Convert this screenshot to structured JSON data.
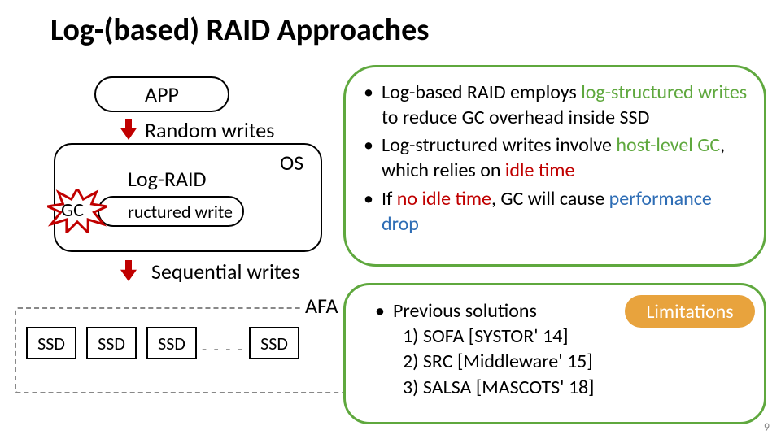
{
  "title": "Log-(based) RAID Approaches",
  "left": {
    "app": "APP",
    "random_writes": "Random writes",
    "os": "OS",
    "log_raid": "Log-RAID",
    "structured_write": "ructured write",
    "gc": "GC",
    "sequential_writes": "Sequential writes",
    "afa": "AFA",
    "ssd": "SSD",
    "dots": "- - - -"
  },
  "bubble1": {
    "b1_pre": "Log-based RAID employs ",
    "b1_hl": "log-structured writes",
    "b1_post": " to reduce GC overhead inside SSD",
    "b2_pre": "Log-structured writes involve ",
    "b2_hl": "host-level GC",
    "b2_mid": ", which relies on ",
    "b2_hl2": "idle time",
    "b3_pre": "If ",
    "b3_hl": "no idle time",
    "b3_mid": ", GC will cause ",
    "b3_hl2": "performance drop"
  },
  "lim": "Limitations",
  "bubble2": {
    "head": "Previous solutions",
    "l1": "1) SOFA [SYSTOR' 14]",
    "l2": "2) SRC [Middleware' 15]",
    "l3": "3) SALSA [MASCOTS' 18]"
  },
  "pagenum": "9"
}
